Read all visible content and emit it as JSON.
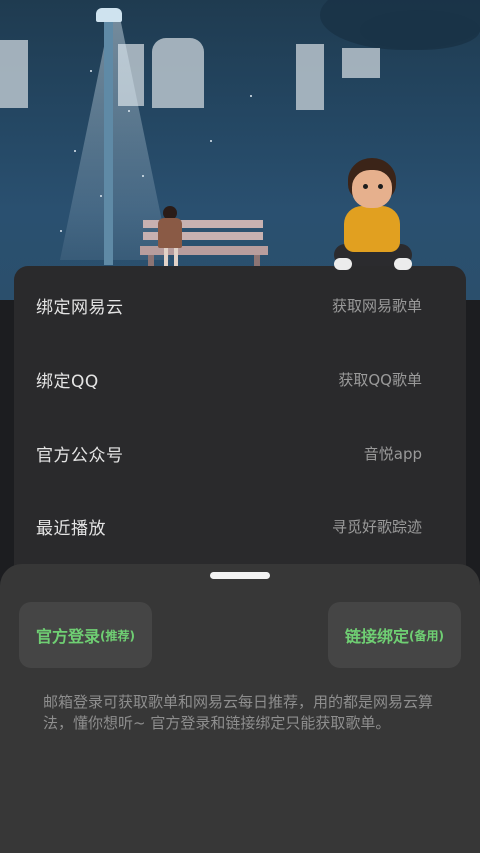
{
  "menu": {
    "items": [
      {
        "title": "绑定网易云",
        "subtitle": "获取网易歌单"
      },
      {
        "title": "绑定QQ",
        "subtitle": "获取QQ歌单"
      },
      {
        "title": "官方公众号",
        "subtitle": "音悦app"
      },
      {
        "title": "最近播放",
        "subtitle": "寻觅好歌踪迹"
      }
    ]
  },
  "sheet": {
    "official_login": {
      "label": "官方登录",
      "tag": "(推荐)"
    },
    "link_bind": {
      "label": "链接绑定",
      "tag": "(备用)"
    },
    "hint": "邮箱登录可获取歌单和网易云每日推荐，用的都是网易云算法，懂你想听~ 官方登录和链接绑定只能获取歌单。"
  },
  "colors": {
    "accent": "#6fcf73",
    "card": "#2a2a2c",
    "sheet": "#373737",
    "button": "#454545"
  }
}
